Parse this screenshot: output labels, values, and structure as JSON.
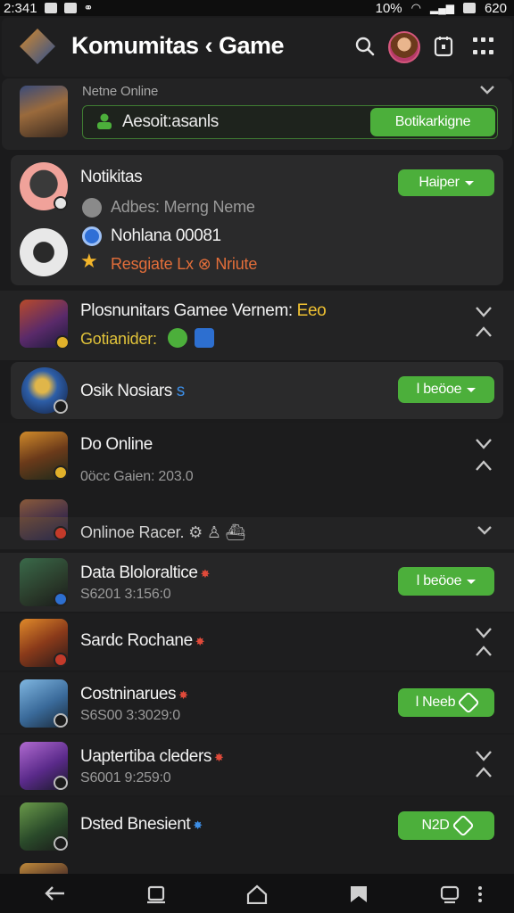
{
  "status": {
    "time": "2:341",
    "battery_pct": "10%",
    "clock_right": "620"
  },
  "header": {
    "title": "Komumitas ‹ Game",
    "icons": [
      "game-logo-icon",
      "search-icon",
      "avatar",
      "tablet-icon",
      "grid-menu-icon"
    ]
  },
  "top_card": {
    "label": "Netne Online",
    "input_value": "Aesoit:asanls",
    "button_label": "Botikarkigne"
  },
  "featured": {
    "title": "Notikitas",
    "line1": "Adbes: Merng Neme",
    "line2": "Nohlana 00081",
    "line3": "Resgiate Lx ⊗ Nriute",
    "button_label": "Haiper"
  },
  "items": [
    {
      "title": "Plosnunitars Gamee Vernem: ",
      "title_accent": "Eeo",
      "sub": "Gotianider:",
      "button_label": ""
    },
    {
      "title": "Osik Nosiars",
      "title_accent": "s",
      "sub": "",
      "button_label": "l beöoe"
    },
    {
      "title": "Do Online",
      "sub": "0öcc Gaien: 203.0",
      "button_label": ""
    },
    {
      "title": "Onlinoe Racer.",
      "sub": "",
      "button_label": ""
    },
    {
      "title": "Data Bloloraltice",
      "sub": "S6201 3:156:0",
      "button_label": "l beöoe"
    },
    {
      "title": "Sardc Rochane",
      "sub": "",
      "button_label": ""
    },
    {
      "title": "Costninarues",
      "sub": "S6S00 3:3029:0",
      "button_label": "l Neeb"
    },
    {
      "title": "Uaptertiba cleders",
      "sub": "S6001 9:259:0",
      "button_label": ""
    },
    {
      "title": "Dsted Bnesient",
      "sub": "",
      "button_label": "N2D"
    }
  ],
  "nav": [
    "back-icon",
    "recents-icon",
    "home-icon",
    "bookmark-icon",
    "chat-icon",
    "more-icon"
  ],
  "colors": {
    "accent_green": "#4caf3b",
    "background": "#1b1b1c",
    "card": "#262627"
  }
}
